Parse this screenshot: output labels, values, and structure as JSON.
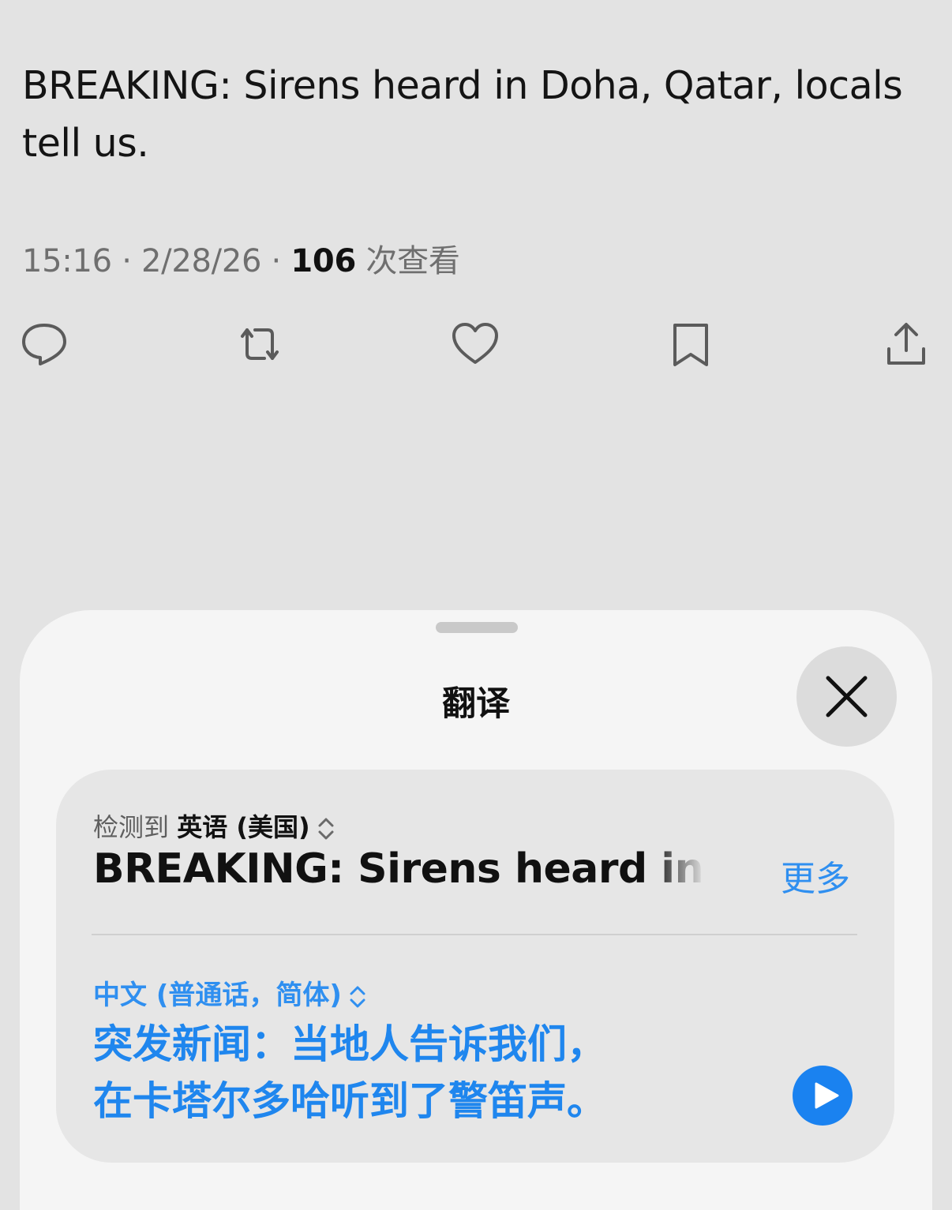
{
  "tweet": {
    "text": "BREAKING: Sirens heard in Doha, Qatar, locals tell us.",
    "time": "15:16",
    "date": "2/28/26",
    "views_count": "106",
    "views_label": "次查看",
    "separator": " · "
  },
  "actions": {
    "icons": [
      "reply-icon",
      "retweet-icon",
      "like-icon",
      "bookmark-icon",
      "share-icon"
    ]
  },
  "translate_sheet": {
    "title": "翻译",
    "source_prefix": "检测到",
    "source_language": "英语 (美国)",
    "source_text": "BREAKING: Sirens heard in Doha, Qatar, locals tell us.",
    "more_label": "更多",
    "target_language": "中文 (普通话，简体)",
    "translated_line1": "突发新闻：当地人告诉我们，",
    "translated_line2": "在卡塔尔多哈听到了警笛声。"
  },
  "colors": {
    "accent": "#2f8ff0",
    "background": "#e3e3e3",
    "sheet": "#f5f5f5"
  }
}
